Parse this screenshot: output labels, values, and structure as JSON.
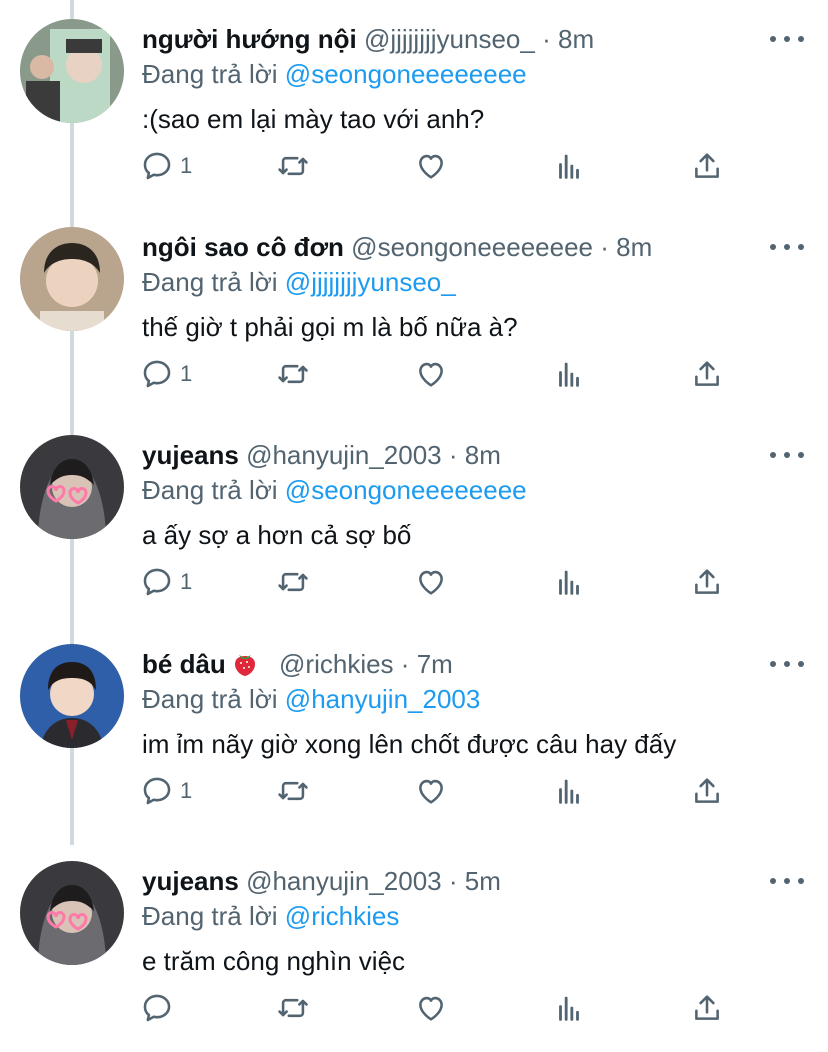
{
  "colors": {
    "text": "#0f1419",
    "secondary": "#536471",
    "accent": "#1d9bf0",
    "thread": "#cfd9de"
  },
  "reply_prefix": "Đang trả lời",
  "tweets": [
    {
      "name": "người hướng nội",
      "handle": "@jjjjjjjjyunseo_",
      "time": "8m",
      "reply_to": "@seongoneeeeeeee",
      "text": ":(sao em lại mày tao với anh?",
      "reply_count": "1"
    },
    {
      "name": "ngôi sao cô đơn",
      "handle": "@seongoneeeeeeee",
      "time": "8m",
      "reply_to": "@jjjjjjjjyunseo_",
      "text": "thế giờ t phải gọi m là bố nữa à?",
      "reply_count": "1"
    },
    {
      "name": "yujeans",
      "handle": "@hanyujin_2003",
      "time": "8m",
      "reply_to": "@seongoneeeeeeee",
      "text": "a ấy sợ a hơn cả sợ bố",
      "reply_count": "1"
    },
    {
      "name": "bé dâu",
      "name_emoji": "strawberry-emoji",
      "handle": "@richkies",
      "time": "7m",
      "reply_to": "@hanyujin_2003",
      "text": "im ỉm nãy giờ xong lên chốt được câu hay đấy",
      "reply_count": "1"
    },
    {
      "name": "yujeans",
      "handle": "@hanyujin_2003",
      "time": "5m",
      "reply_to": "@richkies",
      "text": "e trăm công nghìn việc",
      "reply_count": ""
    }
  ],
  "icons": [
    "reply-icon",
    "retweet-icon",
    "like-icon",
    "analytics-icon",
    "share-icon",
    "more-icon"
  ]
}
